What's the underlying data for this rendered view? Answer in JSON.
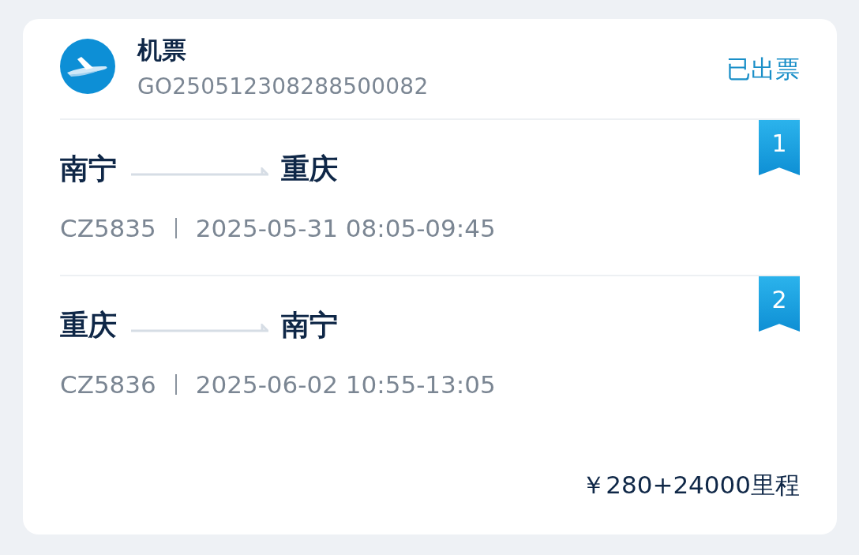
{
  "order": {
    "title": "机票",
    "number": "GO250512308288500082",
    "status": "已出票"
  },
  "segments": [
    {
      "badge": "1",
      "from": "南宁",
      "to": "重庆",
      "flight_no": "CZ5835",
      "schedule": "2025-05-31 08:05-09:45"
    },
    {
      "badge": "2",
      "from": "重庆",
      "to": "南宁",
      "flight_no": "CZ5836",
      "schedule": "2025-06-02 10:55-13:05"
    }
  ],
  "price": "￥280+24000里程"
}
